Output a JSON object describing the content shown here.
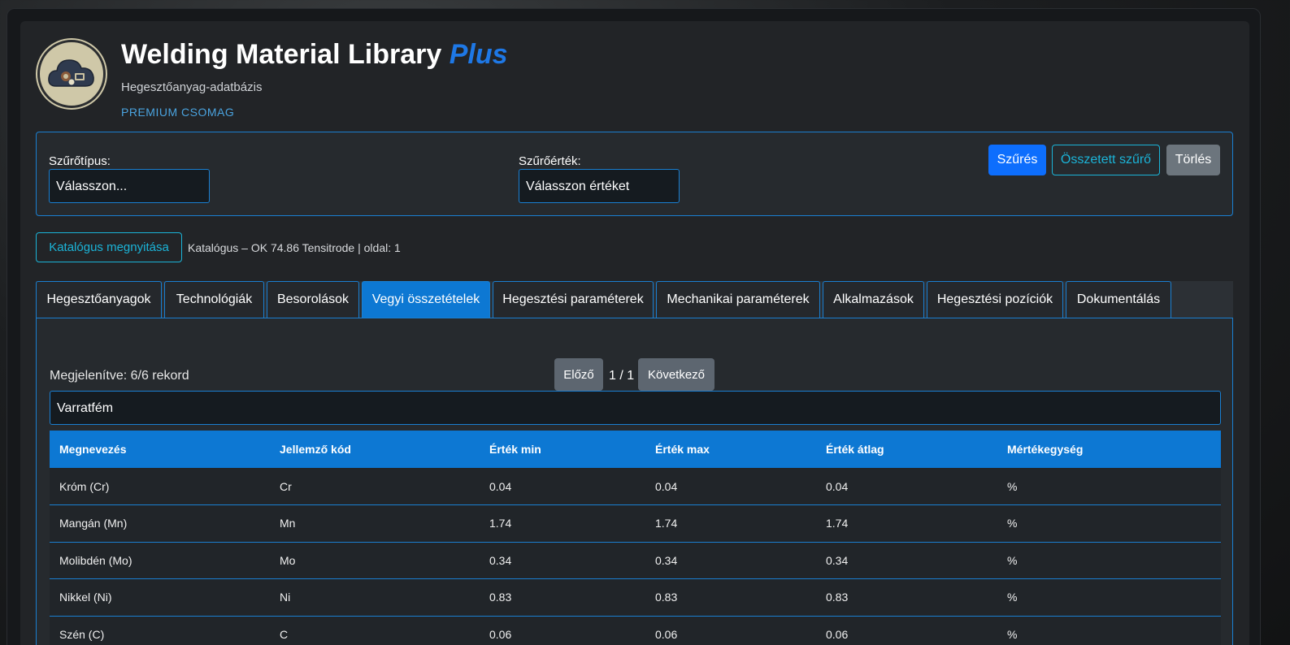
{
  "header": {
    "title_main": "Welding Material Library",
    "title_accent": "Plus",
    "subtitle": "Hegesztőanyag-adatbázis",
    "package": "PREMIUM CSOMAG"
  },
  "filter": {
    "type_label": "Szűrőtípus:",
    "type_value": "Válasszon...",
    "value_label": "Szűrőérték:",
    "value_value": "Válasszon értéket",
    "filter_button": "Szűrés",
    "combined_button": "Összetett szűrő",
    "clear_button": "Törlés"
  },
  "catalog": {
    "open_button": "Katalógus megnyitása",
    "info": "Katalógus – OK 74.86 Tensitrode | oldal: 1"
  },
  "tabs": [
    {
      "label": "Hegesztőanyagok"
    },
    {
      "label": "Technológiák"
    },
    {
      "label": "Besorolások"
    },
    {
      "label": "Vegyi összetételek"
    },
    {
      "label": "Hegesztési paraméterek"
    },
    {
      "label": "Mechanikai paraméterek"
    },
    {
      "label": "Alkalmazások"
    },
    {
      "label": "Hegesztési pozíciók"
    },
    {
      "label": "Dokumentálás"
    }
  ],
  "active_tab": "Vegyi összetételek",
  "panel": {
    "records": "Megjelenítve: 6/6 rekord",
    "prev_button": "Előző",
    "page": "1 / 1",
    "next_button": "Következő",
    "group": "Varratfém"
  },
  "table": {
    "headers": [
      "Megnevezés",
      "Jellemző kód",
      "Érték min",
      "Érték max",
      "Érték átlag",
      "Mértékegység"
    ],
    "rows": [
      [
        "Króm (Cr)",
        "Cr",
        "0.04",
        "0.04",
        "0.04",
        "%"
      ],
      [
        "Mangán (Mn)",
        "Mn",
        "1.74",
        "1.74",
        "1.74",
        "%"
      ],
      [
        "Molibdén (Mo)",
        "Mo",
        "0.34",
        "0.34",
        "0.34",
        "%"
      ],
      [
        "Nikkel (Ni)",
        "Ni",
        "0.83",
        "0.83",
        "0.83",
        "%"
      ],
      [
        "Szén (C)",
        "C",
        "0.06",
        "0.06",
        "0.06",
        "%"
      ]
    ]
  },
  "colors": {
    "accent": "#0d78d3",
    "primary_button": "#0d6efd",
    "outline_cyan": "#1bb4d8",
    "background": "#222427"
  }
}
